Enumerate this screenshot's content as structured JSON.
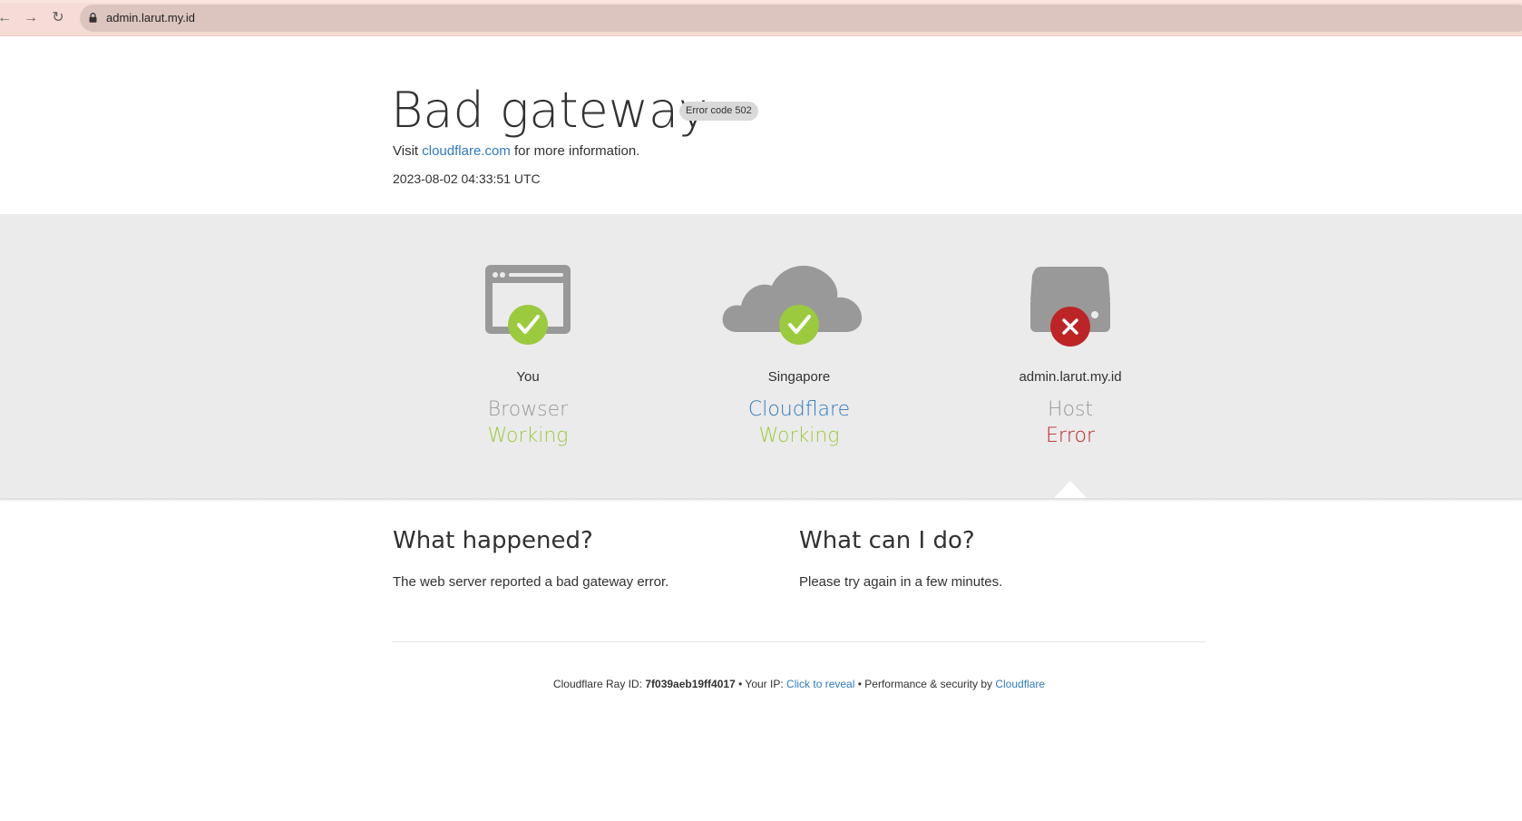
{
  "browser": {
    "url": "admin.larut.my.id"
  },
  "header": {
    "title": "Bad gateway",
    "error_badge": "Error code 502",
    "visit_prefix": "Visit",
    "visit_link": "cloudflare.com",
    "visit_suffix": "for more information.",
    "timestamp": "2023-08-02 04:33:51 UTC"
  },
  "status": [
    {
      "location": "You",
      "name": "Browser",
      "state": "Working",
      "icon": "browser-icon",
      "badge": "check-icon"
    },
    {
      "location": "Singapore",
      "name": "Cloudflare",
      "state": "Working",
      "icon": "cloud-icon",
      "badge": "check-icon"
    },
    {
      "location": "admin.larut.my.id",
      "name": "Host",
      "state": "Error",
      "icon": "server-icon",
      "badge": "x-icon"
    }
  ],
  "what_happened": {
    "heading": "What happened?",
    "text": "The web server reported a bad gateway error."
  },
  "what_can_i_do": {
    "heading": "What can I do?",
    "text": "Please try again in a few minutes."
  },
  "footer": {
    "ray_label": "Cloudflare Ray ID:",
    "ray_id": "7f039aeb19ff4017",
    "sep1": "•",
    "ip_label": "Your IP:",
    "ip_link": "Click to reveal",
    "sep2": "•",
    "perf_label": "Performance & security by",
    "perf_link": "Cloudflare"
  },
  "colors": {
    "working": "#9bca3e",
    "error": "#bd2426",
    "link": "#2f7bbf",
    "icon_gray": "#999999",
    "band_bg": "#ebebeb"
  }
}
